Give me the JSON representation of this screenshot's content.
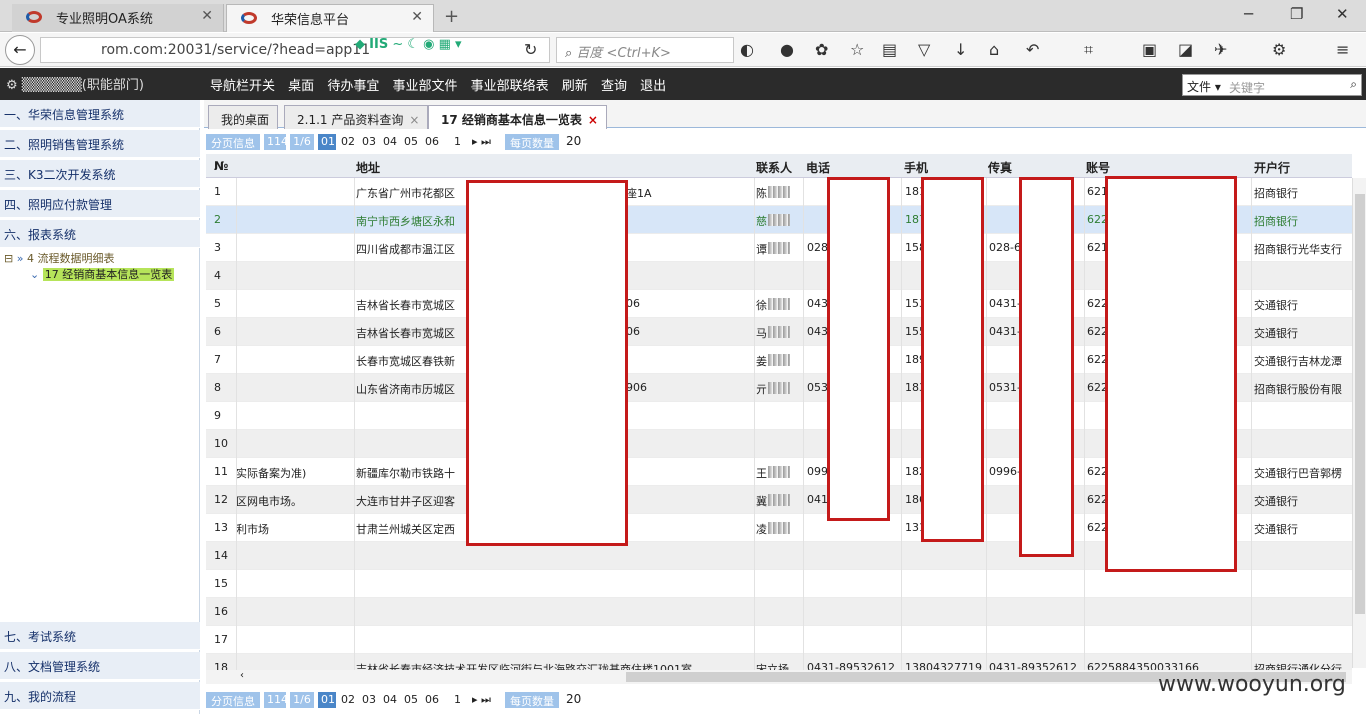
{
  "browser": {
    "tabs": [
      {
        "title": "专业照明OA系统",
        "active": false
      },
      {
        "title": "华荣信息平台",
        "active": true
      }
    ],
    "new_tab": "+",
    "url": "rom.com:20031/service/?head=app11",
    "url_icons": "IIS",
    "search_placeholder": "百度 <Ctrl+K>",
    "window_controls": [
      "─",
      "❐",
      "✕"
    ]
  },
  "app": {
    "logo_text": "(职能部门)",
    "menu": [
      "导航栏开关",
      "桌面",
      "待办事宜",
      "事业部文件",
      "事业部联络表",
      "刷新",
      "查询",
      "退出"
    ],
    "search_select": "文件 ▾",
    "search_placeholder": "关键字"
  },
  "sidebar": {
    "items": [
      "一、华荣信息管理系统",
      "二、照明销售管理系统",
      "三、K3二次开发系统",
      "四、照明应付款管理",
      "六、报表系统"
    ],
    "tree": {
      "parent": "4 流程数据明细表",
      "child": "17 经销商基本信息一览表"
    },
    "bottom_items": [
      "七、考试系统",
      "八、文档管理系统",
      "九、我的流程"
    ]
  },
  "content_tabs": [
    {
      "label": "我的桌面",
      "closable": false,
      "active": false
    },
    {
      "label": "2.1.1 产品资料查询",
      "closable": true,
      "active": false
    },
    {
      "label": "17 经销商基本信息一览表",
      "closable": true,
      "active": true
    }
  ],
  "pager": {
    "info_label": "分页信息",
    "total": "114",
    "pages": "1/6",
    "page_links": [
      "01",
      "02",
      "03",
      "04",
      "05",
      "06"
    ],
    "current_page": "1",
    "nav": "▸ ⏭",
    "size_label": "每页数量",
    "size": "20"
  },
  "table": {
    "headers": [
      "№",
      "地址",
      "联系人",
      "电话",
      "手机",
      "传真",
      "账号",
      "开户行"
    ],
    "rows": [
      {
        "no": "1",
        "prefix": "",
        "addr": "广东省广州市花都区",
        "addr2": "座1A",
        "contact": "陈",
        "phone": "",
        "mobile": "181",
        "fax": "",
        "account": "621",
        "bank": "招商银行"
      },
      {
        "no": "2",
        "prefix": "",
        "addr": "南宁市西乡塘区永和",
        "addr2": "",
        "contact": "慈",
        "phone": "",
        "mobile": "187",
        "fax": "",
        "account": "622",
        "bank": "招商银行"
      },
      {
        "no": "3",
        "prefix": "",
        "addr": "四川省成都市温江区",
        "addr2": "",
        "contact": "谭",
        "phone": "028",
        "mobile": "158",
        "fax": "028-6",
        "account": "621",
        "bank": "招商银行光华支行"
      },
      {
        "no": "4",
        "prefix": "",
        "addr": "",
        "addr2": "",
        "contact": "",
        "phone": "",
        "mobile": "",
        "fax": "",
        "account": "",
        "bank": ""
      },
      {
        "no": "5",
        "prefix": "",
        "addr": "吉林省长春市宽城区",
        "addr2": "06",
        "contact": "徐",
        "phone": "043",
        "mobile": "153",
        "fax": "0431-",
        "account": "622",
        "bank": "交通银行"
      },
      {
        "no": "6",
        "prefix": "",
        "addr": "吉林省长春市宽城区",
        "addr2": "06",
        "contact": "马",
        "phone": "043",
        "mobile": "155",
        "fax": "0431-",
        "account": "622",
        "bank": "交通银行"
      },
      {
        "no": "7",
        "prefix": "",
        "addr": "长春市宽城区春铁新",
        "addr2": "",
        "contact": "姜",
        "phone": "",
        "mobile": "189",
        "fax": "",
        "account": "622",
        "bank": "交通银行吉林龙潭"
      },
      {
        "no": "8",
        "prefix": "",
        "addr": "山东省济南市历城区",
        "addr2": "906",
        "contact": "亓",
        "phone": "053",
        "mobile": "183",
        "fax": "0531-",
        "account": "622",
        "bank": "招商银行股份有限"
      },
      {
        "no": "9",
        "prefix": "",
        "addr": "",
        "addr2": "",
        "contact": "",
        "phone": "",
        "mobile": "",
        "fax": "",
        "account": "",
        "bank": ""
      },
      {
        "no": "10",
        "prefix": "",
        "addr": "",
        "addr2": "",
        "contact": "",
        "phone": "",
        "mobile": "",
        "fax": "",
        "account": "",
        "bank": ""
      },
      {
        "no": "11",
        "prefix": "实际备案为准)",
        "addr": "新疆库尔勒市铁路十",
        "addr2": "",
        "contact": "王",
        "phone": "099",
        "mobile": "182",
        "fax": "0996-",
        "account": "622",
        "bank": "交通银行巴音郭楞"
      },
      {
        "no": "12",
        "prefix": "区网电市场。",
        "addr": "大连市甘井子区迎客",
        "addr2": "",
        "contact": "冀",
        "phone": "041",
        "mobile": "186",
        "fax": "",
        "account": "622",
        "bank": "交通银行"
      },
      {
        "no": "13",
        "prefix": "利市场",
        "addr": "甘肃兰州城关区定西",
        "addr2": "",
        "contact": "凌",
        "phone": "",
        "mobile": "131",
        "fax": "",
        "account": "622",
        "bank": "交通银行"
      },
      {
        "no": "14",
        "prefix": "",
        "addr": "",
        "addr2": "",
        "contact": "",
        "phone": "",
        "mobile": "",
        "fax": "",
        "account": "",
        "bank": ""
      },
      {
        "no": "15",
        "prefix": "",
        "addr": "",
        "addr2": "",
        "contact": "",
        "phone": "",
        "mobile": "",
        "fax": "",
        "account": "",
        "bank": ""
      },
      {
        "no": "16",
        "prefix": "",
        "addr": "",
        "addr2": "",
        "contact": "",
        "phone": "",
        "mobile": "",
        "fax": "",
        "account": "",
        "bank": ""
      },
      {
        "no": "17",
        "prefix": "",
        "addr": "",
        "addr2": "",
        "contact": "",
        "phone": "",
        "mobile": "",
        "fax": "",
        "account": "",
        "bank": ""
      },
      {
        "no": "18",
        "prefix": "",
        "addr": "吉林省长春市经济技术开发区临河街与北海路交汇珑基商住楼1001室",
        "addr2": "",
        "contact": "宋立扬",
        "phone": "0431-89532612",
        "mobile": "13804327719",
        "fax": "0431-89352612",
        "account": "6225884350033166",
        "bank": "招商银行通化分行"
      }
    ]
  },
  "watermark": "www.wooyun.org",
  "colors": {
    "redact": "#c41a1a",
    "selected_row": "#d7e6f8",
    "tree_highlight": "#b6e45a",
    "pager_blue": "#9fc3ea"
  }
}
